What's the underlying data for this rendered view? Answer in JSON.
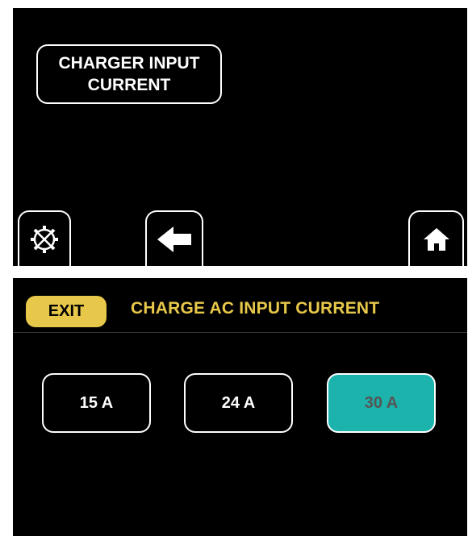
{
  "top_screen": {
    "title_line1": "CHARGER INPUT",
    "title_line2": "CURRENT",
    "nav": {
      "settings_icon": "settings-gear-wrench-icon",
      "back_icon": "back-arrow-icon",
      "home_icon": "home-icon"
    }
  },
  "bottom_screen": {
    "exit_label": "EXIT",
    "title": "CHARGE AC INPUT CURRENT",
    "options": [
      {
        "label": "15 A",
        "selected": false
      },
      {
        "label": "24 A",
        "selected": false
      },
      {
        "label": "30 A",
        "selected": true
      }
    ]
  },
  "colors": {
    "accent": "#e8c84a",
    "selected": "#1cb3ad",
    "background": "#000000",
    "border": "#ffffff"
  }
}
